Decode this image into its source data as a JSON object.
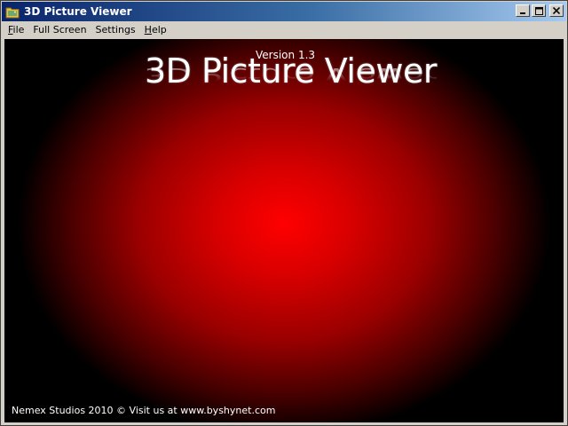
{
  "window": {
    "title": "3D Picture Viewer",
    "icon": "folder-picture-icon",
    "buttons": [
      "minimize-icon",
      "maximize-icon",
      "close-icon"
    ]
  },
  "menu": {
    "items": [
      {
        "accel": "F",
        "rest": "ile"
      },
      {
        "accel": "",
        "rest": "Full Screen"
      },
      {
        "accel": "",
        "rest": "Settings"
      },
      {
        "accel": "H",
        "rest": "elp"
      }
    ]
  },
  "splash": {
    "version": "Version 1.3",
    "title": "3D Picture Viewer",
    "footer": "Nemex Studios 2010 © Visit us at www.byshynet.com"
  },
  "colors": {
    "glow_center": "#ff0000",
    "background": "#000000",
    "titlebar_start": "#0a246a",
    "titlebar_end": "#a6caf0"
  }
}
